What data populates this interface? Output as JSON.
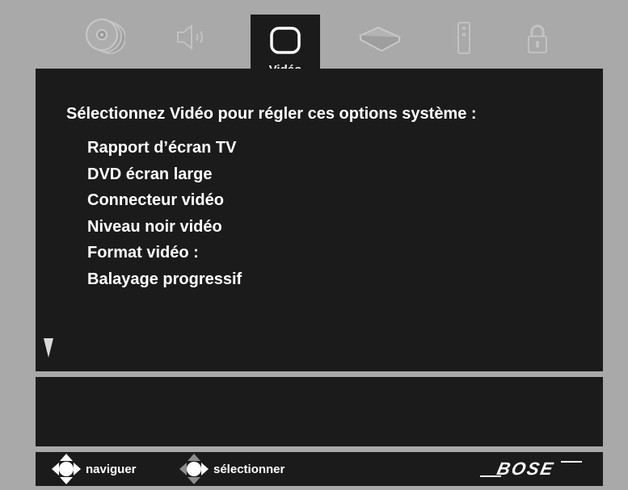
{
  "tabs": [
    {
      "icon": "disc-stack-icon"
    },
    {
      "icon": "speaker-icon"
    },
    {
      "icon": "tv-screen-icon",
      "label": "Vidéo",
      "selected": true
    },
    {
      "icon": "device-icon"
    },
    {
      "icon": "remote-icon"
    },
    {
      "icon": "lock-icon"
    }
  ],
  "main": {
    "heading": "Sélectionnez Vidéo pour régler ces options système :",
    "options": [
      "Rapport d’écran TV",
      "DVD écran large",
      "Connecteur vidéo",
      "Niveau noir vidéo",
      "Format vidéo :",
      "Balayage progressif"
    ]
  },
  "footer": {
    "navigate_label": "naviguer",
    "select_label": "sélectionner",
    "brand": "BOSE"
  },
  "colors": {
    "background": "#a9a9a9",
    "panel": "#1b1b1b",
    "inactive_icon": "#bdbdbd",
    "text": "#ffffff"
  }
}
